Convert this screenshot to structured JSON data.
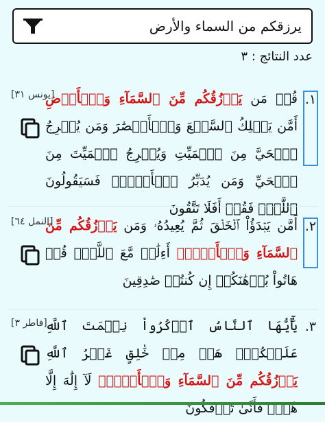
{
  "search": {
    "query": "يرزقكم من السماء والأرض"
  },
  "results_count": "عدد النتائج : ٣",
  "results": [
    {
      "number": "١.",
      "reference": "[يونس ٣١]",
      "verse_prefix": "قُلۡ مَن ",
      "verse_highlight": "يَرۡزُقُكُم مِّنَ ٱلسَّمَآءِ وَٱلۡأَرۡضِ",
      "verse_suffix": " أَمَّن يَمۡلِكُ ٱلسَّمۡعَ وَٱلۡأَبۡصَٰرَ وَمَن يُخۡرِجُ ٱلۡحَيَّ مِنَ ٱلۡمَيِّتِ وَيُخۡرِجُ ٱلۡمَيِّتَ مِنَ ٱلۡحَيِّ وَمَن يُدَبِّرُ ٱلۡأَمۡرَۚ فَسَيَقُولُونَ ٱللَّهُۚ فَقُلۡ أَفَلَا تَتَّقُونَ"
    },
    {
      "number": "٢.",
      "reference": "[النمل ٦٤]",
      "verse_prefix": "أَمَّن يَبۡدَؤُاْ ٱلۡخَلۡقَ ثُمَّ يُعِيدُهُۥ وَمَن ",
      "verse_highlight": "يَرۡزُقُكُم مِّنَ ٱلسَّمَآءِ وَٱلۡأَرۡضِۗ",
      "verse_suffix": " أَءِلَٰهٞ مَّعَ ٱللَّهِۚ قُلۡ هَاتُواْ بُرۡهَٰنَكُمۡ إِن كُنتُمۡ صَٰدِقِينَ"
    },
    {
      "number": "٣.",
      "reference": "[فاطر ٣]",
      "verse_prefix": "يَٰٓأَيُّهَا ٱلنَّاسُ ٱذۡكُرُواْ نِعۡمَتَ ٱللَّهِ عَلَيۡكُمۡۚ هَلۡ مِنۡ خَٰلِقٍ غَيۡرُ ٱللَّهِ ",
      "verse_highlight": "يَرۡزُقُكُم مِّنَ ٱلسَّمَآءِ وَٱلۡأَرۡضِۚ",
      "verse_suffix": " لَآ إِلَٰهَ إِلَّا هُوَۖ فَأَنَّىٰ تُؤۡفَكُونَ"
    }
  ]
}
